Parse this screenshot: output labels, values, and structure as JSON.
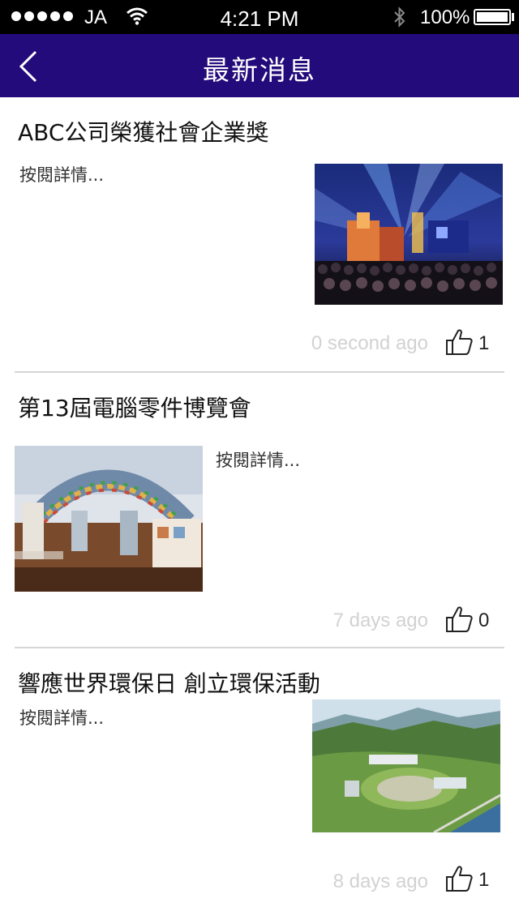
{
  "status_bar": {
    "carrier": "JA",
    "time": "4:21 PM",
    "battery": "100%",
    "signal_icon": "signal-dots-icon",
    "wifi_icon": "wifi-icon",
    "bluetooth_icon": "bluetooth-icon",
    "battery_icon": "battery-icon"
  },
  "nav": {
    "title": "最新消息",
    "back_icon": "chevron-left-icon",
    "bar_color": "#240b7c"
  },
  "news": [
    {
      "title": "ABC公司榮獲社會企業獎",
      "snippet": "按閱詳情...",
      "time": "0 second ago",
      "likes": "1",
      "image": "concert-stage-photo"
    },
    {
      "title": "第13屆電腦零件博覽會",
      "snippet": "按閱詳情...",
      "time": "7 days ago",
      "likes": "0",
      "image": "exhibition-hall-photo"
    },
    {
      "title": "響應世界環保日  創立環保活動",
      "snippet": "按閱詳情...",
      "time": "8 days ago",
      "likes": "1",
      "image": "green-campus-aerial-photo"
    }
  ]
}
